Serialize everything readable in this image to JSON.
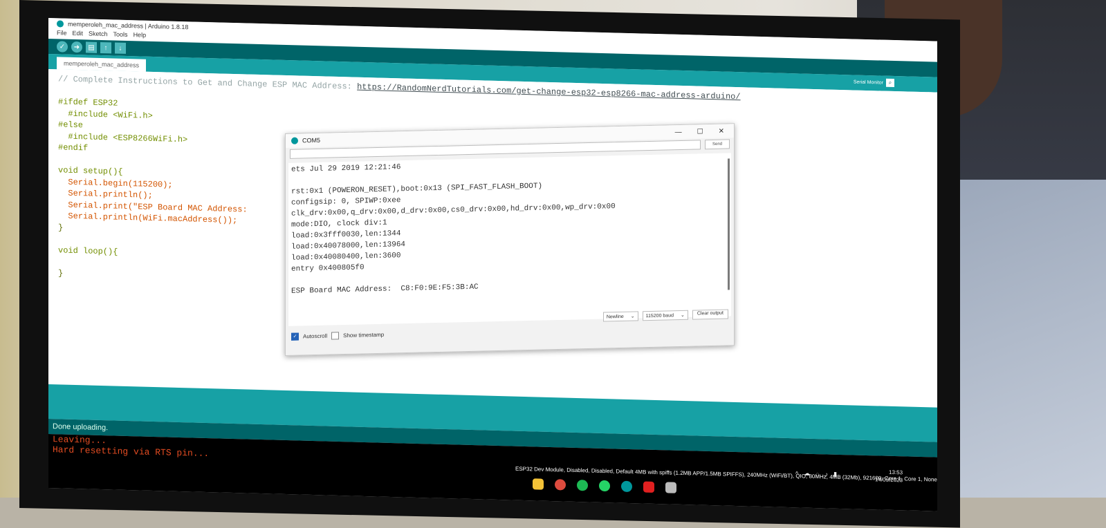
{
  "window": {
    "title": "memperoleh_mac_address | Arduino 1.8.18"
  },
  "menu": [
    "File",
    "Edit",
    "Sketch",
    "Tools",
    "Help"
  ],
  "toolbar": {
    "verify_icon": "check-icon",
    "upload_icon": "arrow-right-icon",
    "new_icon": "file-icon",
    "open_icon": "arrow-up-icon",
    "save_icon": "arrow-down-icon",
    "serial_monitor_label": "Serial Monitor"
  },
  "tabs": [
    {
      "label": "memperoleh_mac_address"
    }
  ],
  "editor": {
    "comment_prefix": "// Complete Instructions to Get and Change ESP MAC Address: ",
    "comment_url": "https://RandomNerdTutorials.com/get-change-esp32-esp8266-mac-address-arduino/",
    "lines": [
      "#ifdef ESP32",
      "  #include <WiFi.h>",
      "#else",
      "  #include <ESP8266WiFi.h>",
      "#endif",
      "",
      "void setup(){",
      "  Serial.begin(115200);",
      "  Serial.println();",
      "  Serial.print(\"ESP Board MAC Address:",
      "  Serial.println(WiFi.macAddress());",
      "}",
      "",
      "void loop(){",
      "",
      "}"
    ]
  },
  "status": {
    "message": "Done uploading.",
    "board_info": "ESP32 Dev Module, Disabled, Disabled, Default 4MB with spiffs (1.2MB APP/1.5MB SPIFFS), 240MHz (WiFi/BT), QIO, 80MHz, 4MB (32Mb), 921600, Core 1, Core 1, None, Disabled on COM5"
  },
  "console": {
    "lines": [
      "Leaving...",
      "Hard resetting via RTS pin..."
    ]
  },
  "serial_monitor": {
    "title": "COM5",
    "send_label": "Send",
    "input_value": "",
    "output": [
      "ets Jul 29 2019 12:21:46",
      "",
      "rst:0x1 (POWERON_RESET),boot:0x13 (SPI_FAST_FLASH_BOOT)",
      "configsip: 0, SPIWP:0xee",
      "clk_drv:0x00,q_drv:0x00,d_drv:0x00,cs0_drv:0x00,hd_drv:0x00,wp_drv:0x00",
      "mode:DIO, clock div:1",
      "load:0x3fff0030,len:1344",
      "load:0x40078000,len:13964",
      "load:0x40080400,len:3600",
      "entry 0x400805f0",
      "",
      "ESP Board MAC Address:  C8:F0:9E:F5:3B:AC"
    ],
    "autoscroll_label": "Autoscroll",
    "autoscroll_checked": true,
    "timestamp_label": "Show timestamp",
    "timestamp_checked": false,
    "line_ending": "Newline",
    "baud": "115200 baud",
    "clear_label": "Clear output"
  },
  "taskbar": {
    "time": "13:53",
    "date": "14/09/2023"
  },
  "colors": {
    "arduino_dark": "#006468",
    "arduino_teal": "#17a1a5",
    "console_error": "#e34c22"
  }
}
